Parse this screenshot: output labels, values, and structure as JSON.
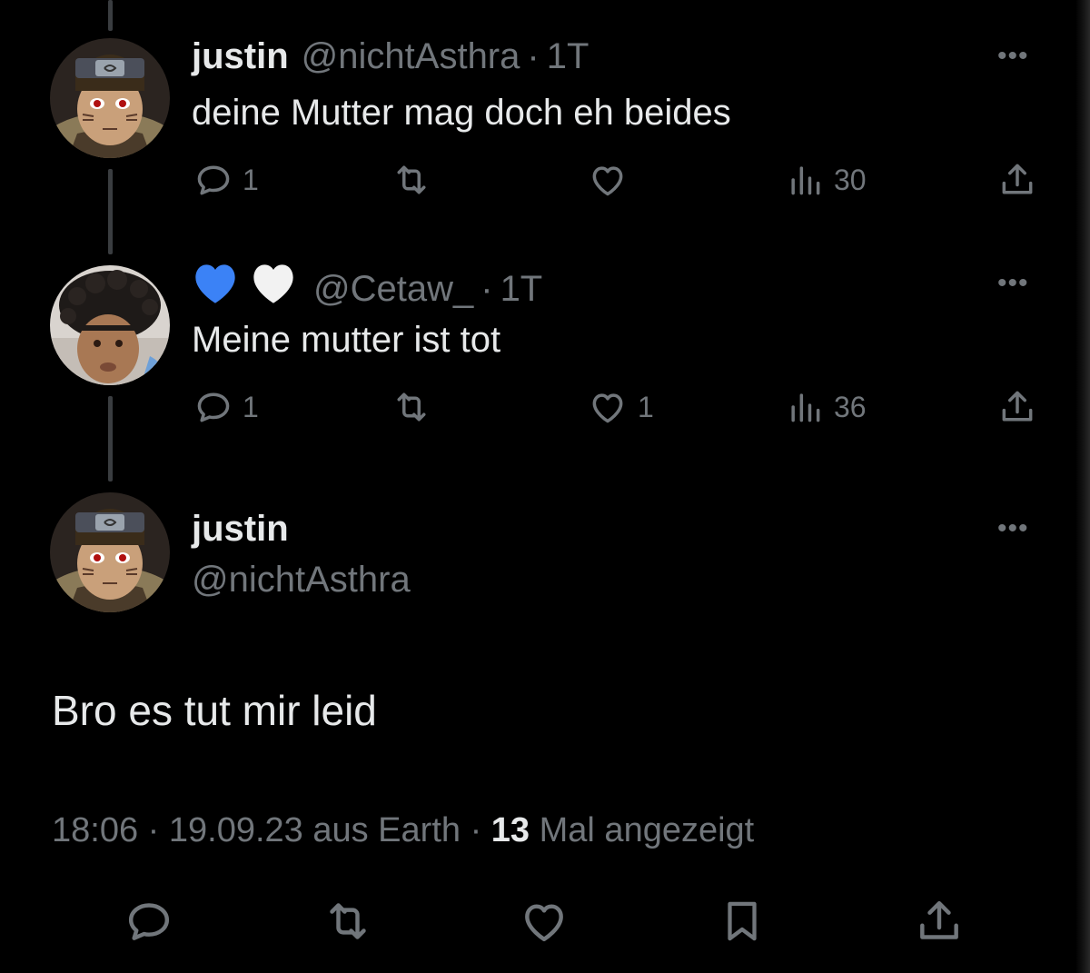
{
  "tweets": [
    {
      "name": "justin",
      "handle": "@nichtAsthra",
      "time": "1T",
      "text": "deine Mutter mag doch eh beides",
      "replies": "1",
      "likes": "",
      "views": "30"
    },
    {
      "name_emoji": [
        "blue-heart",
        "white-heart"
      ],
      "handle": "@Cetaw_",
      "time": "1T",
      "text": "Meine mutter ist tot",
      "replies": "1",
      "likes": "1",
      "views": "36"
    }
  ],
  "main_tweet": {
    "name": "justin",
    "handle": "@nichtAsthra",
    "text": "Bro es tut mir leid",
    "time": "18:06",
    "date": "19.09.23",
    "source": "aus Earth",
    "views_count": "13",
    "views_label": "Mal angezeigt"
  },
  "colors": {
    "background": "#000000",
    "text": "#e7e9ea",
    "muted": "#71767b",
    "thread_line": "#3a3d40",
    "blue_heart": "#3b82f6"
  },
  "icons": [
    "reply-icon",
    "retweet-icon",
    "like-icon",
    "views-icon",
    "share-icon",
    "bookmark-icon",
    "more-icon"
  ]
}
